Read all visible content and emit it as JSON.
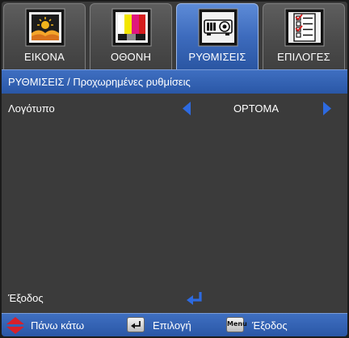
{
  "tabs": [
    {
      "label": "ΕΙΚΟΝΑ",
      "icon": "picture-icon",
      "active": false
    },
    {
      "label": "ΟΘΟΝΗ",
      "icon": "display-color-bars-icon",
      "active": false
    },
    {
      "label": "ΡΥΘΜΙΣΕΙΣ",
      "icon": "projector-icon",
      "active": true
    },
    {
      "label": "ΕΠΙΛΟΓΕΣ",
      "icon": "options-checklist-icon",
      "active": false
    }
  ],
  "breadcrumb": "ΡΥΘΜΙΣΕΙΣ / Προχωρημένες ρυθμίσεις",
  "settings": {
    "logo": {
      "label": "Λογότυπο",
      "value": "OPTOMA"
    },
    "exit": {
      "label": "Έξοδος"
    }
  },
  "help": {
    "updown": "Πάνω κάτω",
    "select": "Επιλογή",
    "menu_key": "Menu",
    "exit": "Έξοδος"
  },
  "colors": {
    "accent_blue": "#2f5fb3",
    "arrow_blue": "#2d6ae0",
    "updown_red": "#d8202a",
    "panel_gray": "#3b3b3b"
  }
}
